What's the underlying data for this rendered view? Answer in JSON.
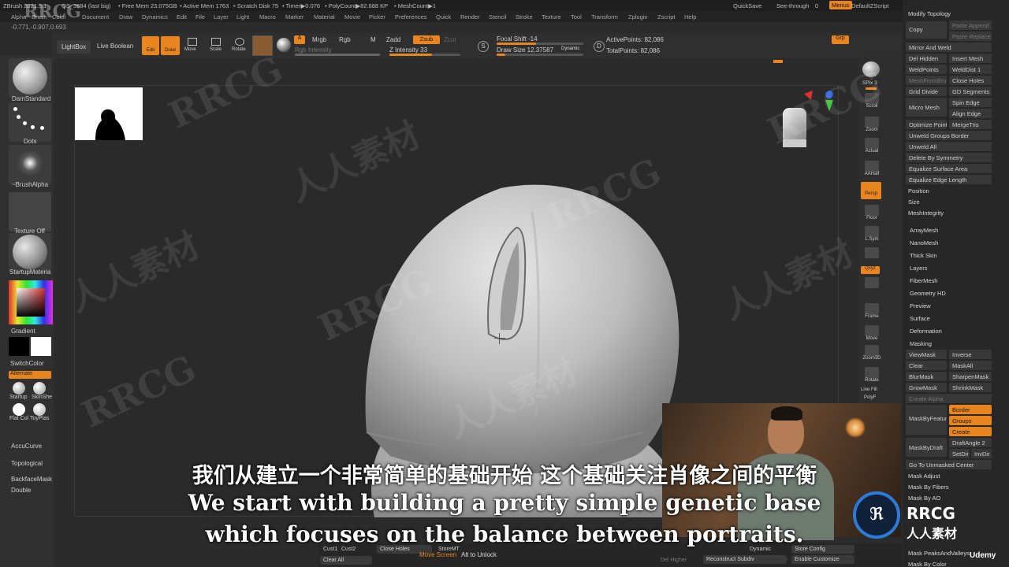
{
  "menubar": {
    "title": "ZBrush 2021.5.1",
    "project": "QS_3684 (last big)",
    "free_mem": "• Free Mem 23.075GB",
    "active_mem": "• Active Mem 1763",
    "scratch": "• Scratch Disk 75",
    "timer": "• Timer▶0.076",
    "polycount": "• PolyCount▶82.688 KP",
    "meshcount": "• MeshCount▶1",
    "quicksave": "QuickSave",
    "seethrough": "See-through",
    "seethrough_val": "0",
    "menus": "Menus",
    "defaultzscript": "DefaultZScript",
    "coords": "-0.771,-0.907,0.693",
    "items": [
      "Alpha",
      "Brush",
      "Color",
      "Document",
      "Draw",
      "Dynamics",
      "Edit",
      "File",
      "Layer",
      "Light",
      "Macro",
      "Marker",
      "Material",
      "Movie",
      "Picker",
      "Preferences",
      "Quick",
      "Render",
      "Stencil",
      "Stroke",
      "Texture",
      "Tool",
      "Transform",
      "Zplugin",
      "Zscript",
      "Help"
    ]
  },
  "toolbar": {
    "lightbox": "LightBox",
    "live_boolean": "Live Boolean",
    "edit": "Edit",
    "draw": "Draw",
    "move": "Move",
    "scale": "Scale",
    "rotate": "Rotate",
    "a": "A",
    "mrgb": "Mrgb",
    "rgb": "Rgb",
    "m": "M",
    "zadd": "Zadd",
    "zsub": "Zsub",
    "zcut": "Zcut",
    "rgb_intensity": "Rgb Intensity",
    "z_intensity": "Z Intensity 33",
    "focal_shift": "Focal Shift -14",
    "draw_size": "Draw Size 12.37587",
    "dynamic": "Dynamic",
    "active_points": "ActivePoints: 82,086",
    "total_points": "TotalPoints: 82,086",
    "grp": "Grp",
    "s": "S",
    "d": "D"
  },
  "leftshelf": {
    "brush": "DamStandard",
    "stroke": "Dots",
    "alpha": "~BrushAlpha",
    "texture": "Texture Off",
    "material": "StartupMateria",
    "gradient": "Gradient",
    "switchcolor": "SwitchColor",
    "alternate": "Alternate",
    "mat1": "Startup",
    "mat2": "SkinShe",
    "mat3": "Flat Col",
    "mat4": "ToyPlas",
    "accucurve": "AccuCurve",
    "topological": "Topological",
    "backface": "BackfaceMask",
    "double": "Double"
  },
  "rightshelf": {
    "items": [
      "BPR",
      "SPix 3",
      "Scroll",
      "Zoom",
      "Actual",
      "AAHalf",
      "Persp",
      "Floor",
      "L.Sym",
      "",
      "Qxyz",
      "",
      "Frame",
      "Move",
      "Zoom3D",
      "Rotate",
      "Line Fill",
      "PolyF"
    ]
  },
  "rightpanel": {
    "header": "Modify Topology",
    "copy": "Copy",
    "paste_append": "Paste Append",
    "paste_replace": "Paste Replace",
    "mirror_weld": "Mirror And Weld",
    "del_hidden": "Del Hidden",
    "insert_mesh": "Insert Mesh",
    "weld_points": "WeldPoints",
    "weld_dist": "WeldDist 1",
    "mesh_from_brush": "MeshFromBrus",
    "close_holes": "Close Holes",
    "grid_divide": "Grid Divide",
    "gd_segments": "GD Segments",
    "micro_mesh": "Micro Mesh",
    "spin_edge": "Spin Edge",
    "align_edge": "Align Edge",
    "optimize_point": "Optimize Point",
    "merge_tris": "MergeTris",
    "unweld_groups": "Unweld Groups Border",
    "unweld_all": "Unweld All",
    "delete_symmetry": "Delete By Symmetry",
    "equalize_area": "Equalize Surface Area",
    "equalize_edge": "Equalize Edge Length",
    "position": "Position",
    "size": "Size",
    "mesh_integrity": "MeshIntegrity",
    "subpalettes": [
      "ArrayMesh",
      "NanoMesh",
      "Thick Skin",
      "Layers",
      "FiberMesh",
      "Geometry HD",
      "Preview",
      "Surface",
      "Deformation"
    ],
    "masking": "Masking",
    "view_mask": "ViewMask",
    "inverse": "Inverse",
    "clear": "Clear",
    "mask_all": "MaskAll",
    "blur_mask": "BlurMask",
    "sharpen_mask": "SharpenMask",
    "grow_mask": "GrowMask",
    "shrink_mask": "ShrinkMask",
    "create_alpha": "Create Alpha",
    "border": "Border",
    "groups": "Groups",
    "create": "Create",
    "mask_by_feature": "MaskByFeatur",
    "draft_angle": "DraftAngle 2",
    "mask_by_draft": "MaskByDraft",
    "setdir": "SetDir",
    "invdir": "InvDir",
    "goto_unmasked": "Go To Unmasked Center",
    "mask_adjust": "Mask Adjust",
    "mask_by_fibers": "Mask By Fibers",
    "mask_by_ao": "Mask By AO",
    "mask_peaks": "Mask PeaksAndValleys",
    "mask_by_color": "Mask By Color"
  },
  "bottombar": {
    "cust1": "Cust1",
    "cust2": "Cust2",
    "clear_all": "Clear All",
    "close_holes": "Close Holes",
    "store_mt": "StoreMT",
    "dynamic": "Dynamic",
    "store_config": "Store Config",
    "del_higher": "Del Higher",
    "reconstruct": "Reconstruct Subdiv",
    "enable_customize": "Enable Customize",
    "move_screen": "Move Screen",
    "alt_unlock": "Alt to Unlock"
  },
  "subtitles": {
    "zh": "我们从建立一个非常简单的基础开始 这个基础关注肖像之间的平衡",
    "en1": "We start with building a pretty simple genetic base",
    "en2": "which focuses on the balance between portraits."
  },
  "watermarks": {
    "rrcg": "RRCG",
    "zh": "人人素材",
    "udemy": "Udemy"
  },
  "colors": {
    "accent": "#e8851e",
    "bg": "#2b2b2b",
    "panel": "#272727"
  }
}
